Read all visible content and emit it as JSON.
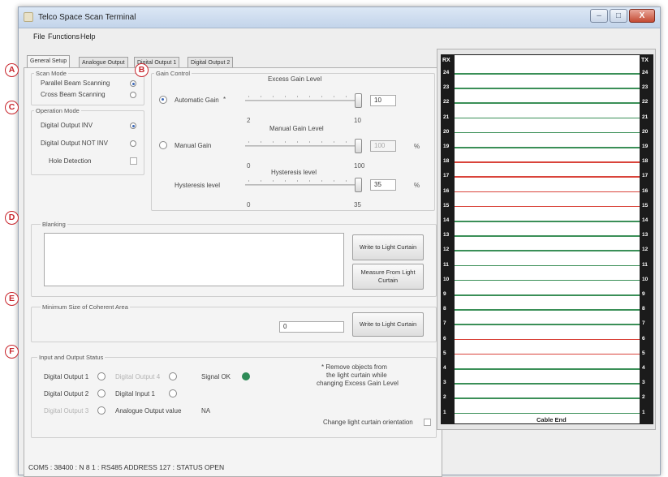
{
  "window": {
    "title": "Telco Space Scan Terminal",
    "buttons": {
      "minimize": "–",
      "maximize": "□",
      "close": "X"
    }
  },
  "menu": [
    "File",
    "Functions",
    "Help"
  ],
  "tabs": [
    {
      "label": "General Setup",
      "active": true
    },
    {
      "label": "Analogue Output"
    },
    {
      "label": "Digital Output 1"
    },
    {
      "label": "Digital Output 2"
    }
  ],
  "markers": [
    "A",
    "B",
    "C",
    "D",
    "E",
    "F"
  ],
  "scan_mode": {
    "title": "Scan Mode",
    "options": [
      {
        "label": "Parallel Beam Scanning",
        "selected": true
      },
      {
        "label": "Cross Beam Scanning",
        "selected": false
      }
    ]
  },
  "operation_mode": {
    "title": "Operation Mode",
    "options": [
      {
        "label": "Digital Output INV",
        "selected": true
      },
      {
        "label": "Digital Output NOT INV",
        "selected": false
      }
    ],
    "hole_detection": {
      "label": "Hole Detection",
      "checked": false
    }
  },
  "gain_control": {
    "title": "Gain Control",
    "automatic": {
      "label": "Automatic Gain",
      "asterisk": "*",
      "selected": true,
      "slider_title": "Excess Gain Level",
      "value": "10",
      "min": "2",
      "max": "10",
      "level": 1.0
    },
    "manual": {
      "label": "Manual Gain",
      "selected": false,
      "slider_title": "Manual Gain Level",
      "value": "100",
      "unit": "%",
      "min": "0",
      "max": "100",
      "level": 1.0
    },
    "hysteresis": {
      "label": "Hysteresis level",
      "slider_title": "Hysteresis level",
      "value": "35",
      "unit": "%",
      "min": "0",
      "max": "35",
      "level": 1.0
    }
  },
  "blanking": {
    "title": "Blanking",
    "value": "",
    "write_button": "Write to Light Curtain",
    "measure_button": "Measure From Light Curtain"
  },
  "coherent": {
    "title": "Minimum Size of Coherent Area",
    "value": "0",
    "write_button": "Write to  Light Curtain"
  },
  "io_status": {
    "title": "Input and Output Status",
    "digital_output_1": "Digital Output 1",
    "digital_output_2": "Digital Output 2",
    "digital_output_3": "Digital Output 3",
    "digital_output_4": "Digital Output 4",
    "digital_input_1": "Digital Input 1",
    "signal_ok": "Signal OK",
    "analogue_output_label": "Analogue Output value",
    "analogue_output_value": "NA"
  },
  "note": {
    "line1": "* Remove objects from",
    "line2": "the light curtain while",
    "line3": "changing Excess Gain Level"
  },
  "orientation": {
    "label": "Change light curtain orientation",
    "checked": false
  },
  "status_bar": "COM5 : 38400 : N 8 1 : RS485 ADDRESS  127 : STATUS  OPEN",
  "curtain": {
    "rx_label": "RX",
    "tx_label": "TX",
    "cable_end": "Cable End",
    "beams": [
      {
        "n": "24",
        "state": "ok"
      },
      {
        "n": "23",
        "state": "ok"
      },
      {
        "n": "22",
        "state": "ok"
      },
      {
        "n": "21",
        "state": "ok"
      },
      {
        "n": "20",
        "state": "ok"
      },
      {
        "n": "19",
        "state": "ok"
      },
      {
        "n": "18",
        "state": "blocked"
      },
      {
        "n": "17",
        "state": "blocked"
      },
      {
        "n": "16",
        "state": "blocked"
      },
      {
        "n": "15",
        "state": "blocked"
      },
      {
        "n": "14",
        "state": "ok"
      },
      {
        "n": "13",
        "state": "ok"
      },
      {
        "n": "12",
        "state": "ok"
      },
      {
        "n": "11",
        "state": "ok"
      },
      {
        "n": "10",
        "state": "ok"
      },
      {
        "n": "9",
        "state": "ok"
      },
      {
        "n": "8",
        "state": "ok"
      },
      {
        "n": "7",
        "state": "ok"
      },
      {
        "n": "6",
        "state": "blocked"
      },
      {
        "n": "5",
        "state": "blocked"
      },
      {
        "n": "4",
        "state": "ok"
      },
      {
        "n": "3",
        "state": "ok"
      },
      {
        "n": "2",
        "state": "ok"
      },
      {
        "n": "1",
        "state": "ok"
      }
    ],
    "colors": {
      "ok": "#3a8f57",
      "blocked": "#d9443b"
    }
  },
  "colors": {
    "accent": "#3c68b8",
    "signal_ok": "#2e8b57",
    "marker": "#c8242b"
  }
}
